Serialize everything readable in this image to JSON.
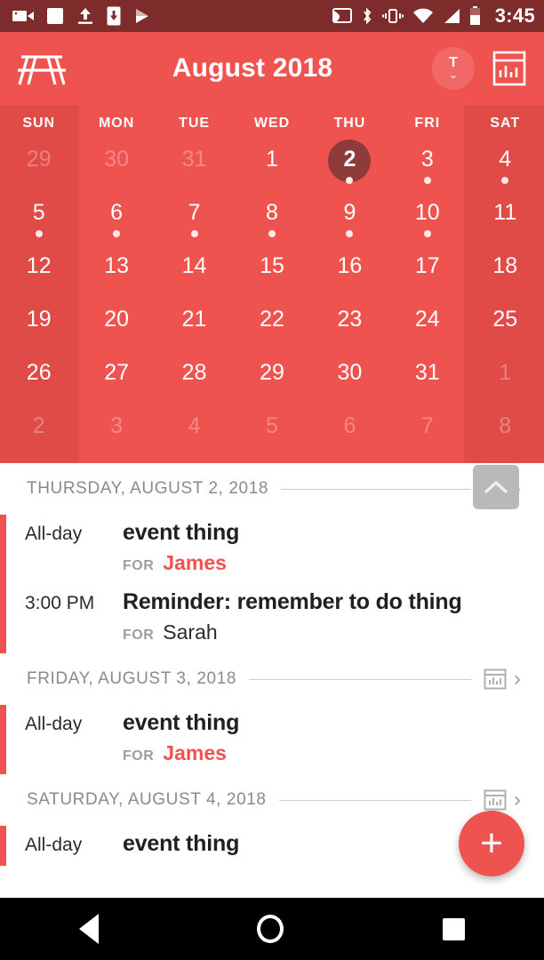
{
  "status_bar": {
    "time": "3:45",
    "left_icons": [
      "video-camera-icon",
      "stop-square-icon",
      "upload-icon",
      "download-to-device-icon",
      "play-store-icon"
    ],
    "right_icons": [
      "cast-icon",
      "bluetooth-icon",
      "vibrate-icon",
      "wifi-icon",
      "cell-signal-icon",
      "battery-icon"
    ],
    "colors": {
      "background": "#7d2b2b",
      "foreground": "#ffffff"
    }
  },
  "app_bar": {
    "title": "August 2018",
    "logo_icon": "picnic-table-logo-icon",
    "today_button": {
      "label": "T",
      "chevron": "⌄",
      "icon": "today-dropdown-icon"
    },
    "agenda_icon": "calendar-agenda-icon",
    "colors": {
      "background": "#ef5350",
      "foreground": "#ffffff"
    }
  },
  "calendar": {
    "day_headers": [
      "SUN",
      "MON",
      "TUE",
      "WED",
      "THU",
      "FRI",
      "SAT"
    ],
    "weekend_columns": [
      0,
      6
    ],
    "selected_day": "2",
    "colors": {
      "background": "#ef5350",
      "weekend_background": "#e04b48",
      "selected_circle": "#8e3b3b",
      "dot": "#fde8e6"
    },
    "weeks": [
      [
        {
          "num": "29",
          "out": true,
          "dot": false
        },
        {
          "num": "30",
          "out": true,
          "dot": false
        },
        {
          "num": "31",
          "out": true,
          "dot": false
        },
        {
          "num": "1",
          "out": false,
          "dot": false
        },
        {
          "num": "2",
          "out": false,
          "dot": true,
          "selected": true
        },
        {
          "num": "3",
          "out": false,
          "dot": true
        },
        {
          "num": "4",
          "out": false,
          "dot": true
        }
      ],
      [
        {
          "num": "5",
          "out": false,
          "dot": true
        },
        {
          "num": "6",
          "out": false,
          "dot": true
        },
        {
          "num": "7",
          "out": false,
          "dot": true
        },
        {
          "num": "8",
          "out": false,
          "dot": true
        },
        {
          "num": "9",
          "out": false,
          "dot": true
        },
        {
          "num": "10",
          "out": false,
          "dot": true
        },
        {
          "num": "11",
          "out": false,
          "dot": false
        }
      ],
      [
        {
          "num": "12",
          "out": false,
          "dot": false
        },
        {
          "num": "13",
          "out": false,
          "dot": false
        },
        {
          "num": "14",
          "out": false,
          "dot": false
        },
        {
          "num": "15",
          "out": false,
          "dot": false
        },
        {
          "num": "16",
          "out": false,
          "dot": false
        },
        {
          "num": "17",
          "out": false,
          "dot": false
        },
        {
          "num": "18",
          "out": false,
          "dot": false
        }
      ],
      [
        {
          "num": "19",
          "out": false,
          "dot": false
        },
        {
          "num": "20",
          "out": false,
          "dot": false
        },
        {
          "num": "21",
          "out": false,
          "dot": false
        },
        {
          "num": "22",
          "out": false,
          "dot": false
        },
        {
          "num": "23",
          "out": false,
          "dot": false
        },
        {
          "num": "24",
          "out": false,
          "dot": false
        },
        {
          "num": "25",
          "out": false,
          "dot": false
        }
      ],
      [
        {
          "num": "26",
          "out": false,
          "dot": false
        },
        {
          "num": "27",
          "out": false,
          "dot": false
        },
        {
          "num": "28",
          "out": false,
          "dot": false
        },
        {
          "num": "29",
          "out": false,
          "dot": false
        },
        {
          "num": "30",
          "out": false,
          "dot": false
        },
        {
          "num": "31",
          "out": false,
          "dot": false
        },
        {
          "num": "1",
          "out": true,
          "dot": false
        }
      ],
      [
        {
          "num": "2",
          "out": true,
          "dot": false
        },
        {
          "num": "3",
          "out": true,
          "dot": false
        },
        {
          "num": "4",
          "out": true,
          "dot": false
        },
        {
          "num": "5",
          "out": true,
          "dot": false
        },
        {
          "num": "6",
          "out": true,
          "dot": false
        },
        {
          "num": "7",
          "out": true,
          "dot": false
        },
        {
          "num": "8",
          "out": true,
          "dot": false
        }
      ]
    ]
  },
  "agenda": {
    "for_label": "FOR",
    "accent_color": "#ef5350",
    "days": [
      {
        "header": "THURSDAY, AUGUST 2, 2018",
        "events": [
          {
            "time": "All-day",
            "title": "event thing",
            "person": "James",
            "person_style": "accent"
          },
          {
            "time": "3:00 PM",
            "title": "Reminder: remember to do thing",
            "person": "Sarah",
            "person_style": "plain"
          }
        ]
      },
      {
        "header": "FRIDAY, AUGUST 3, 2018",
        "events": [
          {
            "time": "All-day",
            "title": "event thing",
            "person": "James",
            "person_style": "accent"
          }
        ]
      },
      {
        "header": "SATURDAY, AUGUST 4, 2018",
        "events": [
          {
            "time": "All-day",
            "title": "event thing",
            "person": "",
            "person_style": "accent"
          }
        ]
      }
    ]
  },
  "fab": {
    "label": "+",
    "icon": "add-event-icon",
    "color": "#ef5350"
  },
  "scroll_to_top": {
    "icon": "chevron-up-icon"
  },
  "nav_bar": {
    "back": "back-icon",
    "home": "home-icon",
    "recents": "recents-icon"
  }
}
